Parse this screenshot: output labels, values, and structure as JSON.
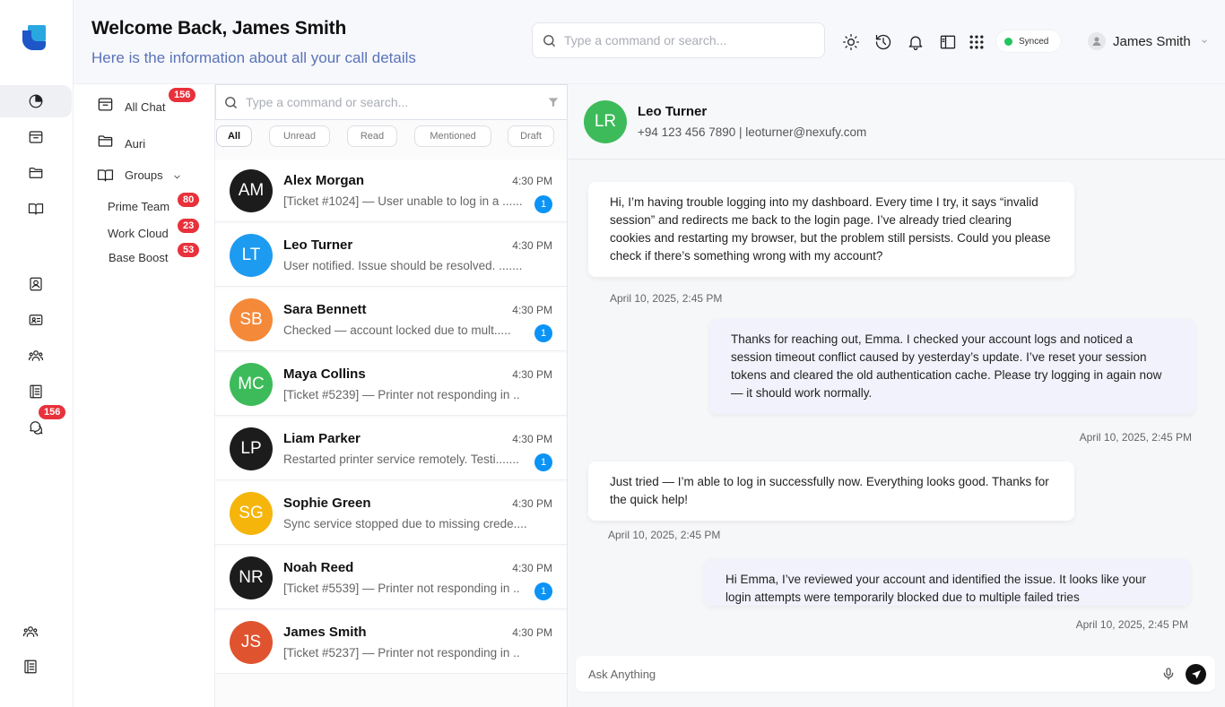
{
  "header": {
    "welcome": "Welcome Back, James Smith",
    "subtitle": "Here is the information about all your call details",
    "search_placeholder": "Type a command or search...",
    "synced_label": "Synced",
    "user_name": "James Smith"
  },
  "rail": {
    "badge": "156"
  },
  "folders": {
    "all_chat": "All Chat",
    "all_chat_badge": "156",
    "auri": "Auri",
    "groups": "Groups",
    "subgroups": [
      {
        "label": "Prime Team",
        "badge": "80"
      },
      {
        "label": "Work Cloud",
        "badge": "23"
      },
      {
        "label": "Base Boost",
        "badge": "53"
      }
    ]
  },
  "list": {
    "search_placeholder": "Type a command or search...",
    "filters": [
      "All",
      "Unread",
      "Read",
      "Mentioned",
      "Draft"
    ],
    "conversations": [
      {
        "initials": "AM",
        "name": "Alex Morgan",
        "time": "4:30 PM",
        "preview": "[Ticket #1024] — User unable to log in a ......",
        "unread": "1",
        "color": "#1c1c1c"
      },
      {
        "initials": "LT",
        "name": "Leo Turner",
        "time": "4:30 PM",
        "preview": "User notified. Issue should be resolved. .......",
        "unread": "",
        "color": "#1d9bf0"
      },
      {
        "initials": "SB",
        "name": "Sara Bennett",
        "time": "4:30 PM",
        "preview": "Checked — account locked due to mult.....",
        "unread": "1",
        "color": "#f5893a"
      },
      {
        "initials": "MC",
        "name": "Maya Collins",
        "time": "4:30 PM",
        "preview": "[Ticket #5239] — Printer not responding in ..",
        "unread": "",
        "color": "#3dbb5a"
      },
      {
        "initials": "LP",
        "name": "Liam Parker",
        "time": "4:30 PM",
        "preview": "Restarted printer service remotely. Testi.......",
        "unread": "1",
        "color": "#1c1c1c"
      },
      {
        "initials": "SG",
        "name": "Sophie Green",
        "time": "4:30 PM",
        "preview": "Sync service stopped due to missing crede.....",
        "unread": "",
        "color": "#f5b50a"
      },
      {
        "initials": "NR",
        "name": "Noah Reed",
        "time": "4:30 PM",
        "preview": "[Ticket #5539] — Printer not responding in ..",
        "unread": "1",
        "color": "#1c1c1c"
      },
      {
        "initials": "JS",
        "name": "James Smith",
        "time": "4:30 PM",
        "preview": "[Ticket #5237] — Printer not responding in ..",
        "unread": "",
        "color": "#e0532f"
      }
    ]
  },
  "chat": {
    "contact_initials": "LR",
    "contact_name": "Leo Turner",
    "contact_details": "+94 123 456 7890 | leoturner@nexufy.com",
    "messages": [
      {
        "text": "Hi, I’m having trouble logging into my dashboard. Every time I try, it says “invalid session” and redirects me back to the login page. I’ve already tried clearing cookies and restarting my browser, but the problem still persists. Could you please check if there’s something wrong with my account?",
        "time": "April 10, 2025, 2:45 PM"
      },
      {
        "text": "Thanks for reaching out, Emma. I checked your account logs and noticed a session timeout conflict caused by yesterday’s update. I’ve reset your session tokens and cleared the old authentication cache. Please try logging in again now — it should work normally.",
        "time": "April 10, 2025, 2:45 PM"
      },
      {
        "text": "Just tried — I’m able to log in successfully now. Everything looks good. Thanks for the quick help!",
        "time": "April 10, 2025, 2:45 PM"
      },
      {
        "text": "Hi Emma, I’ve reviewed your account and identified the issue. It looks like your login attempts were temporarily blocked due to multiple failed tries",
        "time": "April 10, 2025, 2:45 PM"
      }
    ],
    "composer_placeholder": "Ask Anything"
  },
  "colors": {
    "accent_blue": "#0b93f6",
    "badge_red": "#e8313b",
    "subtitle_blue": "#5a73b8",
    "synced_green": "#22c55e"
  }
}
